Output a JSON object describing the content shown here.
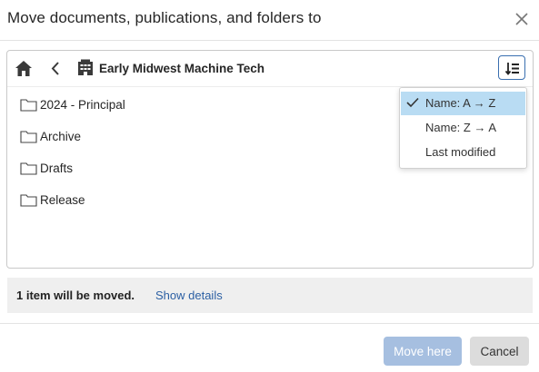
{
  "dialog": {
    "title": "Move documents, publications, and folders to",
    "close_icon": "close-icon"
  },
  "toolbar": {
    "home_icon": "home-icon",
    "back_icon": "chevron-left-icon",
    "location_icon": "building-icon",
    "current_folder": "Early Midwest Machine Tech",
    "sort_icon": "sort-icon"
  },
  "folders": [
    {
      "label": "2024 - Principal",
      "icon": "folder-icon"
    },
    {
      "label": "Archive",
      "icon": "folder-icon"
    },
    {
      "label": "Drafts",
      "icon": "folder-icon"
    },
    {
      "label": "Release",
      "icon": "folder-icon"
    }
  ],
  "sort_menu": {
    "items": [
      {
        "label": "Name: A → Z",
        "selected": true
      },
      {
        "label": "Name: Z → A",
        "selected": false
      },
      {
        "label": "Last modified",
        "selected": false
      }
    ]
  },
  "info": {
    "text": "1 item will be moved.",
    "link": "Show details"
  },
  "footer": {
    "move_label": "Move here",
    "cancel_label": "Cancel"
  },
  "colors": {
    "accent": "#2b5fa3",
    "primary_disabled": "#a6bfe0",
    "selected_menu": "#b9dcf3"
  }
}
